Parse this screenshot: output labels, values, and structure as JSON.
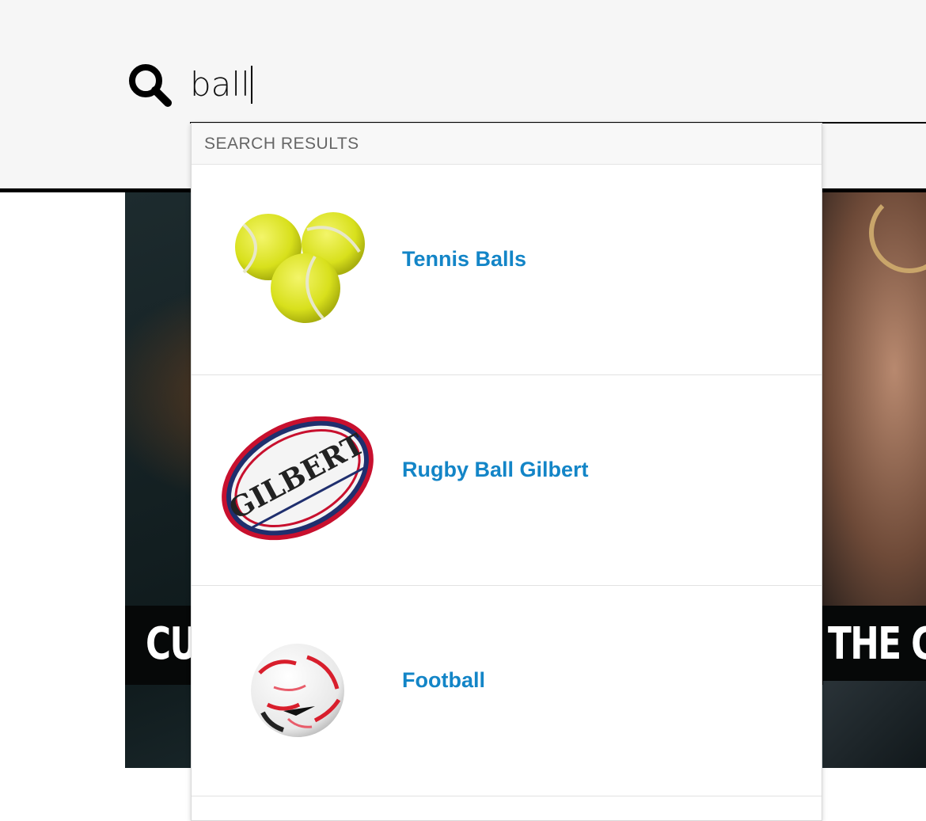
{
  "search": {
    "query": "ball",
    "icon": "search-icon"
  },
  "dropdown": {
    "header": "SEARCH RESULTS",
    "results": [
      {
        "name": "Tennis Balls",
        "image": "tennis-balls-image"
      },
      {
        "name": "Rugby Ball Gilbert",
        "image": "rugby-ball-image"
      },
      {
        "name": "Football",
        "image": "football-image"
      }
    ]
  },
  "hero": {
    "band_left_text": "CU",
    "band_right_text": "THE GA"
  },
  "colors": {
    "link": "#1385c7",
    "header_bg": "#f6f6f6"
  }
}
